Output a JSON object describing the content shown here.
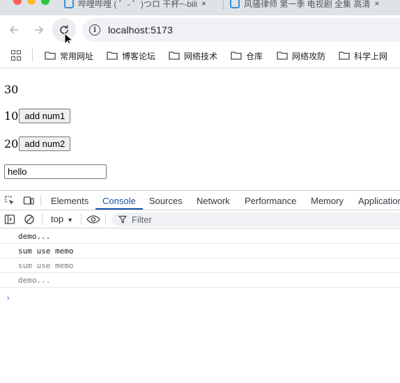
{
  "browser": {
    "tabs": [
      {
        "title": "哔哩哔哩 ( ゜- ゜)つロ 干杯~-bili",
        "close": "×"
      },
      {
        "title": "风骚律师 第一季 电视剧 全集 高清",
        "close": "×"
      }
    ],
    "url": "localhost:5173",
    "info_glyph": "i",
    "bookmarks": [
      "常用网址",
      "博客论坛",
      "网络技术",
      "仓库",
      "网络攻防",
      "科学上网"
    ]
  },
  "page": {
    "sum": "30",
    "num1": "10",
    "add_num1_label": "add num1",
    "num2": "20",
    "add_num2_label": "add num2",
    "input_value": "hello"
  },
  "devtools": {
    "tabs": [
      "Elements",
      "Console",
      "Sources",
      "Network",
      "Performance",
      "Memory",
      "Application"
    ],
    "active_tab": "Console",
    "context": "top",
    "context_arrow": "▼",
    "filter_placeholder": "Filter",
    "logs": [
      {
        "text": "demo...",
        "dim": false
      },
      {
        "text": "sum use memo",
        "dim": false
      },
      {
        "text": "sum use memo",
        "dim": true
      },
      {
        "text": "demo...",
        "dim": true
      }
    ],
    "prompt": "›"
  }
}
